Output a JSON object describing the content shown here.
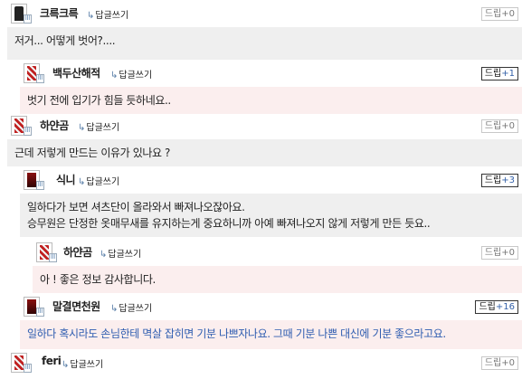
{
  "reply_label": "답글쓰기",
  "comments": [
    {
      "nick": "크륵크륵",
      "badge_label": "드립",
      "badge_count": "+0",
      "lines": [
        "저거... 어떻게 벗어?...."
      ]
    },
    {
      "nick": "백두산해적",
      "badge_label": "드립",
      "badge_count": "+1",
      "lines": [
        "벗기 전에 입기가 힘들 듯하네요.."
      ]
    },
    {
      "nick": "하얀곰",
      "badge_label": "드립",
      "badge_count": "+0",
      "lines": [
        "근데 저렇게 만드는 이유가 있나요 ?"
      ]
    },
    {
      "nick": "식니",
      "badge_label": "드립",
      "badge_count": "+3",
      "lines": [
        "일하다가 보면 셔츠단이 올라와서 빠져나오잖아요.",
        "승무원은 단정한 옷매무새를 유지하는게 중요하니까 아예 빠져나오지 않게 저렇게 만든 듯요.."
      ]
    },
    {
      "nick": "하얀곰",
      "badge_label": "드립",
      "badge_count": "+0",
      "lines": [
        "아 ! 좋은 정보 감사합니다."
      ]
    },
    {
      "nick": "말결면천원",
      "badge_label": "드립",
      "badge_count": "+16",
      "lines": [
        "일하다 혹시라도 손님한테 멱살 잡히면 기분 나쁘자나요. 그때 기분 나쁜 대신에 기분 좋으라고요."
      ]
    },
    {
      "nick": "feri",
      "badge_label": "드립",
      "badge_count": "+0",
      "lines": []
    }
  ],
  "icons": {
    "reply": "reply-arrow-icon",
    "level": "level-icon"
  },
  "colors": {
    "body_gray": "#efefef",
    "body_pink": "#fbeeee",
    "link_blue": "#2f5db0"
  }
}
